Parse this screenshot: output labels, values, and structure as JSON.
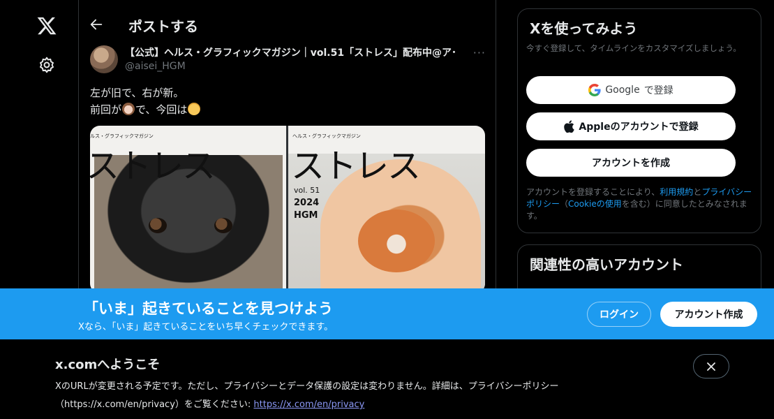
{
  "nav": {
    "logo_icon": "x-logo-icon",
    "settings_icon": "gear-icon"
  },
  "header": {
    "back_icon": "arrow-left-icon",
    "title": "ポストする"
  },
  "post": {
    "author": "【公式】ヘルス・グラフィックマガジン｜vol.51「ストレス」配布中@ア･",
    "handle": "@aisei_HGM",
    "more": "···",
    "line1": "左が旧で、右が新。",
    "line2_a": "前回が",
    "line2_b": "で、今回は",
    "media": {
      "left_small": "ルス・グラフィックマガジン",
      "left_title": "ストレス",
      "right_small": "ヘルス・グラフィックマガジン",
      "right_title": "ストレス",
      "right_vol": "vol. 51",
      "right_year": "2024",
      "right_brand": "HGM"
    }
  },
  "sidebar": {
    "signup_card": {
      "title": "Xを使ってみよう",
      "subtitle": "今すぐ登録して、タイムラインをカスタマイズしましょう。",
      "google_brand": "Google",
      "google_suffix": "で登録",
      "apple_label": "Appleのアカウントで登録",
      "create_label": "アカウントを作成",
      "legal_1": "アカウントを登録することにより、",
      "terms": "利用規約",
      "legal_2": "と",
      "privacy": "プライバシーポリシー",
      "legal_3": "（",
      "cookie": "Cookieの使用",
      "legal_4": "を含む）に同意したとみなされます。"
    },
    "related": {
      "title": "関連性の高いアカウント"
    }
  },
  "banner": {
    "title": "「いま」起きていることを見つけよう",
    "subtitle": "Xなら、「いま」起きていることをいち早くチェックできます。",
    "login": "ログイン",
    "signup": "アカウント作成"
  },
  "notice": {
    "title": "x.comへようこそ",
    "text_1": "XのURLが変更される予定です。ただし、プライバシーとデータ保護の設定は変わりません。詳細は、プライバシーポリシー（https://x.com/en/privacy）をご覧ください: ",
    "url": "https://x.com/en/privacy",
    "close_icon": "close-icon"
  }
}
